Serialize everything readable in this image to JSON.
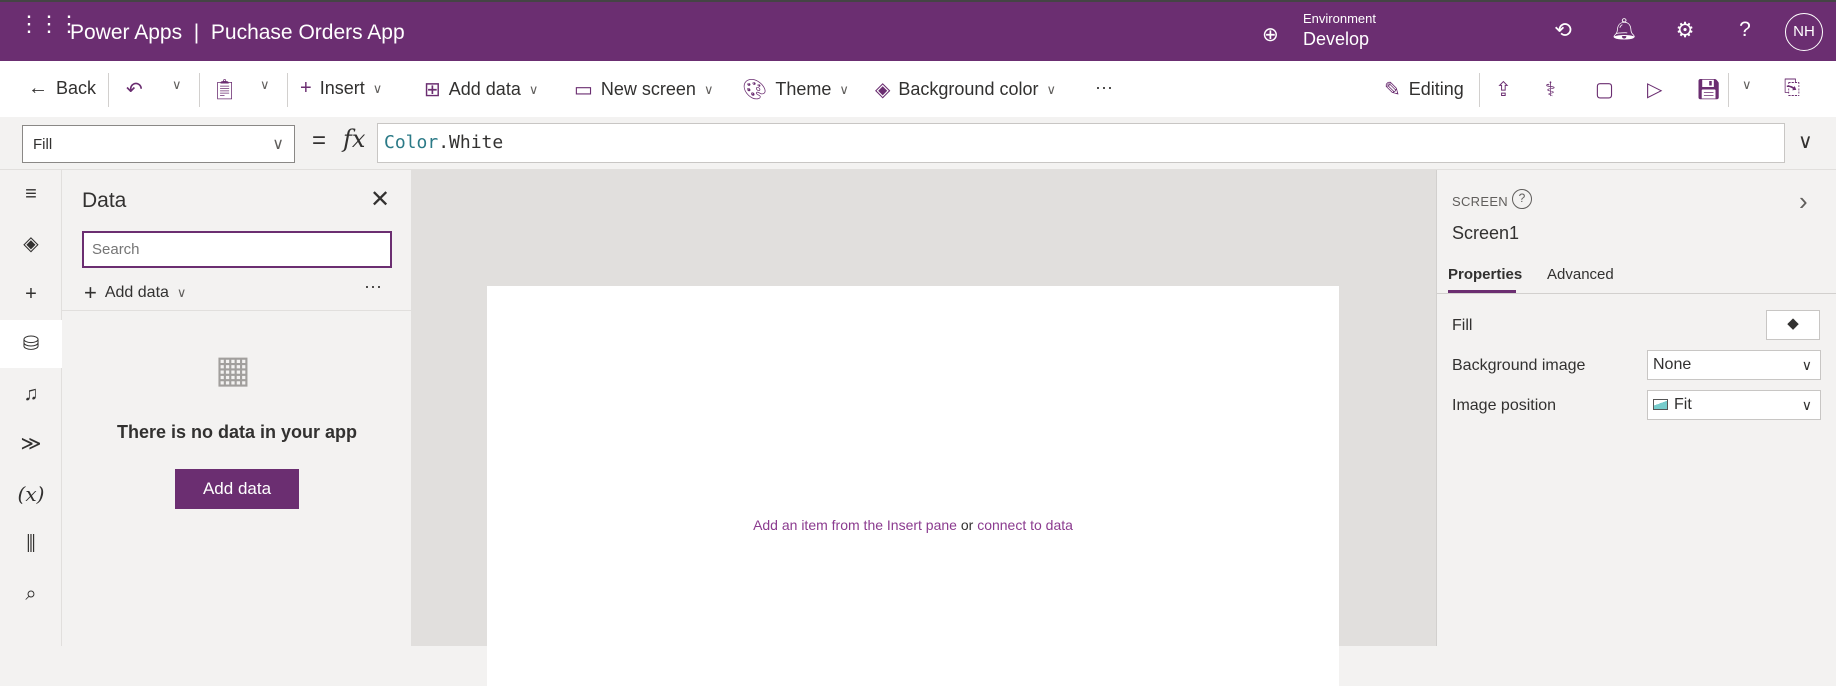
{
  "header": {
    "app": "Power Apps",
    "separator": "|",
    "title": "Puchase Orders App",
    "env_label": "Environment",
    "env_value": "Develop",
    "avatar": "NH"
  },
  "toolbar": {
    "back": "Back",
    "insert": "Insert",
    "add_data": "Add data",
    "new_screen": "New screen",
    "theme": "Theme",
    "background_color": "Background color",
    "more": "···",
    "editing": "Editing"
  },
  "formula": {
    "property": "Fill",
    "equals": "=",
    "fx": "fx",
    "object": "Color",
    "member": ".White"
  },
  "data_panel": {
    "title": "Data",
    "search_placeholder": "Search",
    "add_data": "Add data",
    "more": "···",
    "empty_text": "There is no data in your app",
    "add_button": "Add data"
  },
  "canvas": {
    "hint_prefix": "Add an item from the Insert pane",
    "hint_or": " or ",
    "hint_link": "connect to data"
  },
  "props": {
    "kind": "SCREEN",
    "name": "Screen1",
    "tabs": [
      "Properties",
      "Advanced"
    ],
    "fill_label": "Fill",
    "bg_image_label": "Background image",
    "bg_image_value": "None",
    "img_pos_label": "Image position",
    "img_pos_value": "Fit"
  },
  "colors": {
    "brand": "#6b2e71"
  }
}
